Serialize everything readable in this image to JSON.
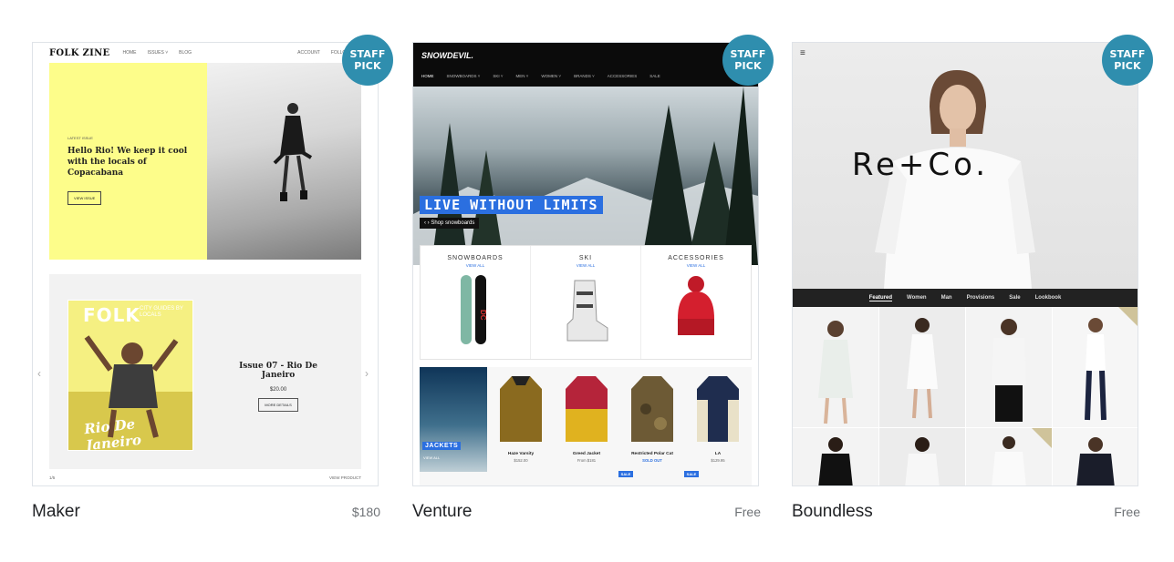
{
  "themes": [
    {
      "name": "Maker",
      "price": "$180",
      "badge": "STAFF\nPICK",
      "preview": {
        "logo": "FOLK ZINE",
        "nav": [
          "HOME",
          "ISSUES ˅",
          "BLOG"
        ],
        "nav_right": [
          "ACCOUNT",
          "FOLLOW"
        ],
        "hero_small": "LATEST ISSUE",
        "hero_heading": "Hello Rio! We keep it cool with the locals of Copacabana",
        "hero_button": "VIEW ISSUE",
        "magazine_title": "FOLK",
        "magazine_sub": "CITY GUIDES BY LOCALS",
        "magazine_script": "Rio De Janeiro",
        "issue_title": "Issue 07 - Rio De Janeiro",
        "issue_price": "$20.00",
        "issue_button": "MORE DETAILS",
        "footer_left": "1/5",
        "footer_right": "VIEW PRODUCT"
      }
    },
    {
      "name": "Venture",
      "price": "Free",
      "badge": "STAFF\nPICK",
      "preview": {
        "logo": "SNOWDEVIL.",
        "nav": [
          "HOME",
          "SNOWBOARDS ˅",
          "SKI ˅",
          "MEN ˅",
          "WOMEN ˅",
          "BRANDS ˅",
          "ACCESSORIES",
          "SALE"
        ],
        "hero_tag": "LIVE WITHOUT LIMITS",
        "hero_shop": "Shop snowboards",
        "categories": [
          {
            "title": "SNOWBOARDS",
            "link": "VIEW ALL"
          },
          {
            "title": "SKI",
            "link": "VIEW ALL"
          },
          {
            "title": "ACCESSORIES",
            "link": "VIEW ALL"
          }
        ],
        "collection_label": "JACKETS",
        "collection_link": "VIEW ALL",
        "products": [
          {
            "name": "Haze Varsity",
            "price": "$152.00",
            "color": "#8a6a1f"
          },
          {
            "name": "Greed Jacket",
            "price": "From $181",
            "color": "#b5243a"
          },
          {
            "name": "Restricted Polar Cat",
            "price": "SOLD OUT",
            "color": "#6d5a35"
          },
          {
            "name": "LA",
            "price": "$129.95",
            "color": "#1f2d4f"
          }
        ],
        "sale": "SALE"
      }
    },
    {
      "name": "Boundless",
      "price": "Free",
      "badge": "STAFF\nPICK",
      "preview": {
        "logo": "Re+Co.",
        "nav": [
          "Featured",
          "Women",
          "Man",
          "Provisions",
          "Sale",
          "Lookbook"
        ]
      }
    }
  ],
  "colors": {
    "badge": "#2f8eae",
    "venture_accent": "#2b6fe0",
    "maker_yellow": "#fdfd8a"
  }
}
